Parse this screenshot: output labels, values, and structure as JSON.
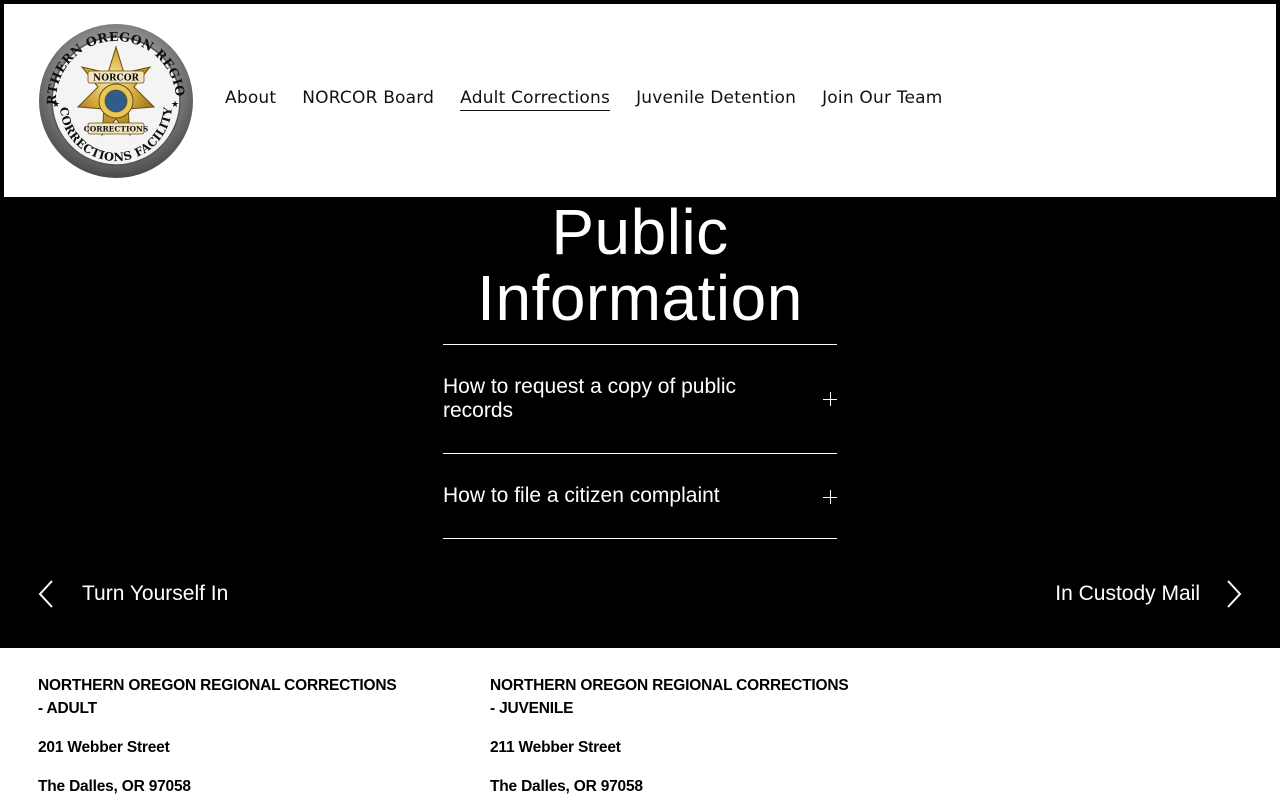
{
  "header": {
    "logo": {
      "ring_text_top": "NORTHERN OREGON REGIONAL",
      "ring_text_bottom": "CORRECTIONS FACILITY",
      "banner_text": "NORCOR",
      "badge_text": "CORRECTIONS",
      "colors": {
        "ring": "#7a7a7a",
        "star": "#c9a227",
        "inner": "#e8c75a"
      }
    },
    "nav": [
      {
        "label": "About",
        "active": false
      },
      {
        "label": "NORCOR Board",
        "active": false
      },
      {
        "label": "Adult Corrections",
        "active": true
      },
      {
        "label": "Juvenile Detention",
        "active": false
      },
      {
        "label": "Join Our Team",
        "active": false
      }
    ]
  },
  "main": {
    "title_line1": "Public",
    "title_line2": "Information",
    "accordion": [
      {
        "title": "How to request a copy of public records"
      },
      {
        "title": "How to file a citizen complaint"
      }
    ],
    "prev_label": "Turn Yourself In",
    "next_label": "In Custody Mail"
  },
  "footer": {
    "columns": [
      {
        "org": "NORTHERN OREGON REGIONAL CORRECTIONS - ADULT",
        "address": "201 Webber Street",
        "city": "The Dalles, OR 97058"
      },
      {
        "org": "NORTHERN OREGON REGIONAL CORRECTIONS - JUVENILE",
        "address": "211 Webber Street",
        "city": "The Dalles, OR 97058"
      }
    ]
  }
}
